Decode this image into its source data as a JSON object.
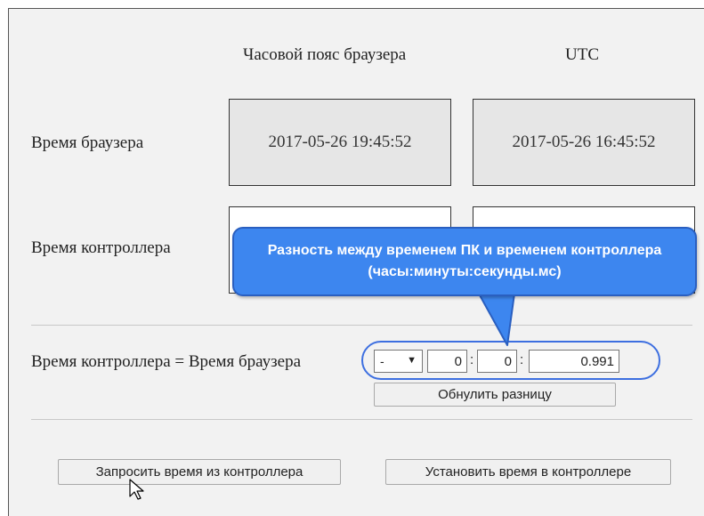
{
  "columns": {
    "browser_tz": "Часовой пояс браузера",
    "utc": "UTC"
  },
  "rows": {
    "browser_time": {
      "label": "Время браузера",
      "local_value": "2017-05-26 19:45:52",
      "utc_value": "2017-05-26 16:45:52"
    },
    "controller_time": {
      "label": "Время контроллера",
      "local_value": "",
      "utc_value": ""
    }
  },
  "equation": {
    "label": "Время контроллера = Время браузера",
    "sign": "-",
    "hours": "0",
    "minutes": "0",
    "seconds": "0.991",
    "separator": ":"
  },
  "buttons": {
    "reset_diff": "Обнулить разницу",
    "request_time": "Запросить время из контроллера",
    "set_time": "Установить время в контроллере"
  },
  "callout": {
    "text": "Разность между временем ПК и временем контроллера (часы:минуты:секунды.мс)"
  },
  "colors": {
    "callout_fill": "#3d86ef",
    "callout_border": "#2a5fc0",
    "panel_background": "#f2f2f2",
    "timebox_background": "#e6e6e6"
  },
  "icons": {
    "cursor": "mouse-pointer-icon",
    "dropdown": "triangle-down-icon"
  }
}
